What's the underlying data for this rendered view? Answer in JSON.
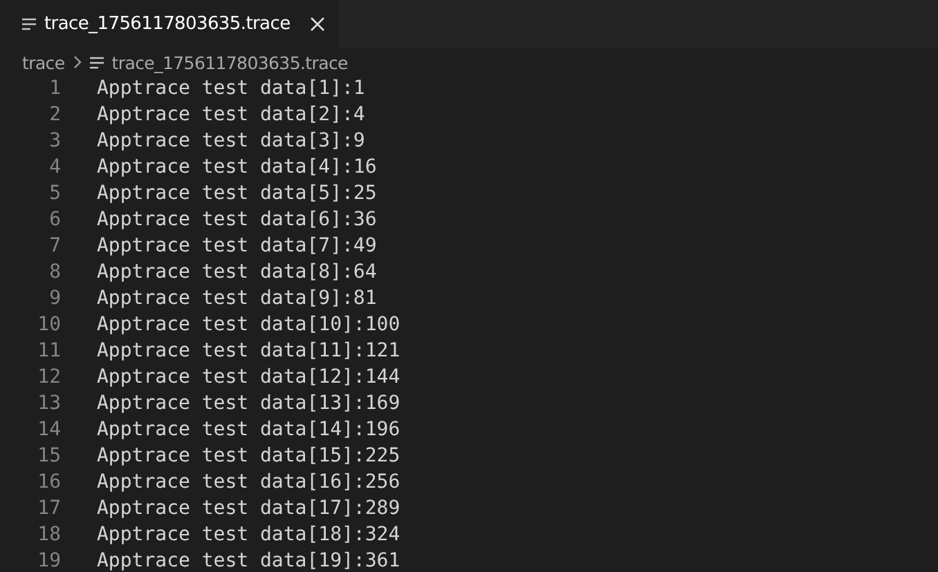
{
  "tabs": [
    {
      "label": "trace_1756117803635.trace",
      "selected": true
    }
  ],
  "breadcrumb": [
    "trace",
    "trace_1756117803635.trace"
  ],
  "lines": [
    {
      "number": "1",
      "text": "Apptrace test data[1]:1"
    },
    {
      "number": "2",
      "text": "Apptrace test data[2]:4"
    },
    {
      "number": "3",
      "text": "Apptrace test data[3]:9"
    },
    {
      "number": "4",
      "text": "Apptrace test data[4]:16"
    },
    {
      "number": "5",
      "text": "Apptrace test data[5]:25"
    },
    {
      "number": "6",
      "text": "Apptrace test data[6]:36"
    },
    {
      "number": "7",
      "text": "Apptrace test data[7]:49"
    },
    {
      "number": "8",
      "text": "Apptrace test data[8]:64"
    },
    {
      "number": "9",
      "text": "Apptrace test data[9]:81"
    },
    {
      "number": "10",
      "text": "Apptrace test data[10]:100"
    },
    {
      "number": "11",
      "text": "Apptrace test data[11]:121"
    },
    {
      "number": "12",
      "text": "Apptrace test data[12]:144"
    },
    {
      "number": "13",
      "text": "Apptrace test data[13]:169"
    },
    {
      "number": "14",
      "text": "Apptrace test data[14]:196"
    },
    {
      "number": "15",
      "text": "Apptrace test data[15]:225"
    },
    {
      "number": "16",
      "text": "Apptrace test data[16]:256"
    },
    {
      "number": "17",
      "text": "Apptrace test data[17]:289"
    },
    {
      "number": "18",
      "text": "Apptrace test data[18]:324"
    },
    {
      "number": "19",
      "text": "Apptrace test data[19]:361"
    }
  ]
}
